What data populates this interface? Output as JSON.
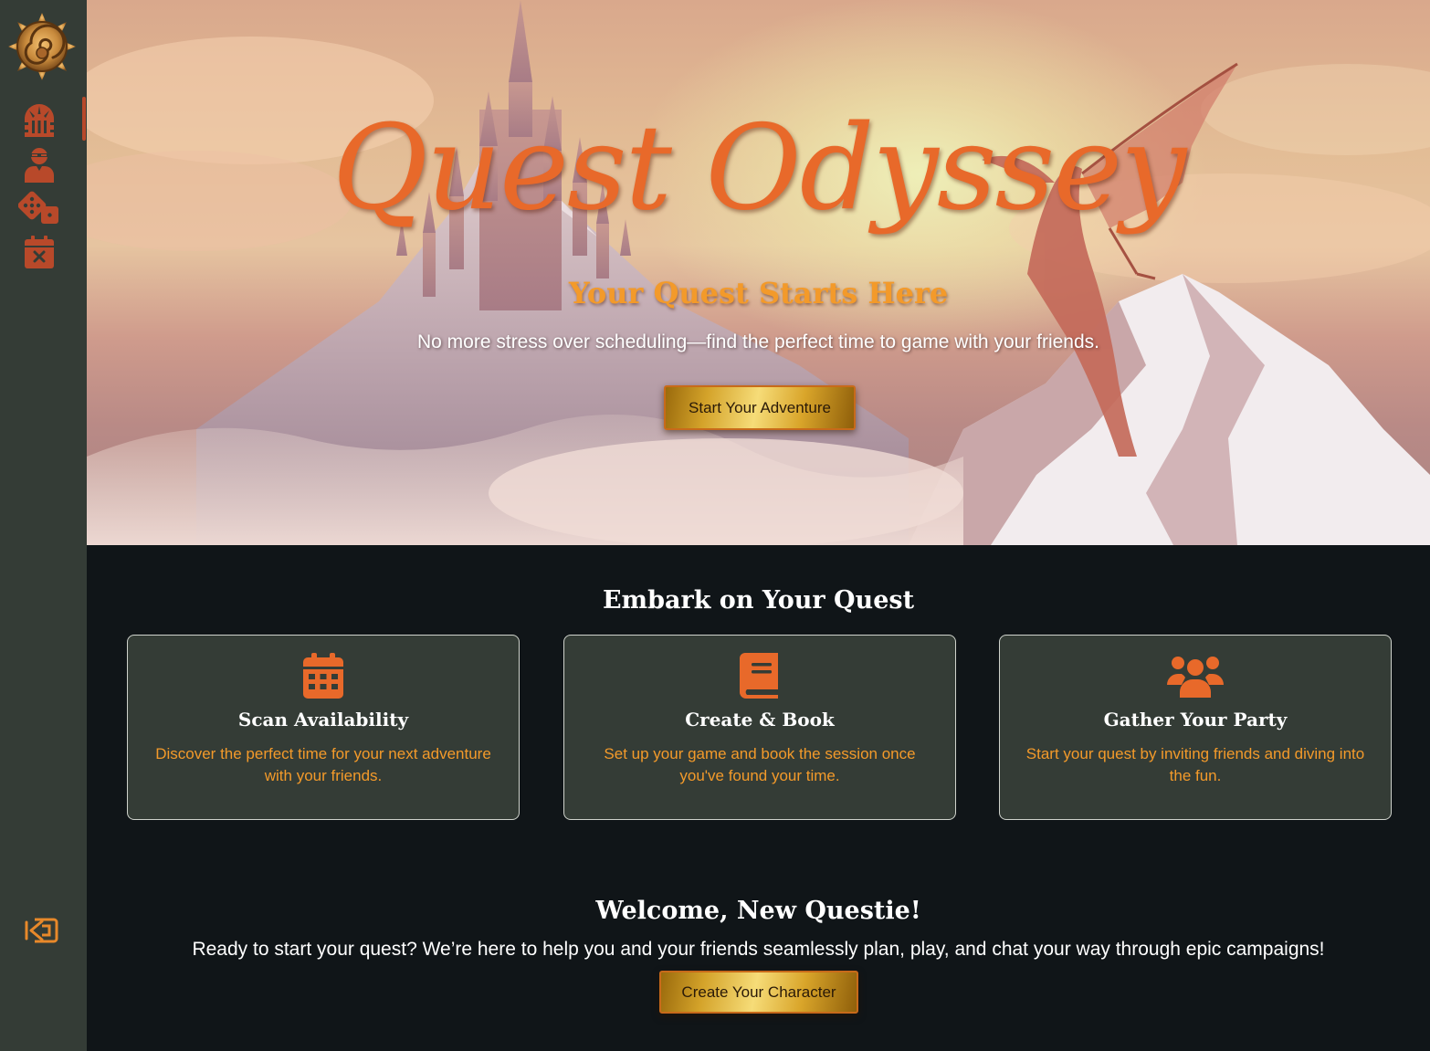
{
  "sidebar": {
    "logo": "spiral-sun-emblem-logo",
    "items": [
      {
        "name": "dungeon-door-icon",
        "active": true
      },
      {
        "name": "character-icon",
        "active": false
      },
      {
        "name": "dice-icon",
        "active": false
      },
      {
        "name": "calendar-cancel-icon",
        "active": false
      }
    ],
    "logout": "logout-icon"
  },
  "hero": {
    "title": "Quest Odyssey",
    "subtitle": "Your Quest Starts Here",
    "tagline": "No more stress over scheduling—find the perfect time to game with your friends.",
    "cta_label": "Start Your Adventure"
  },
  "features": {
    "title": "Embark on Your Quest",
    "cards": [
      {
        "icon": "calendar-icon",
        "title": "Scan Availability",
        "description": "Discover the perfect time for your next adventure with your friends."
      },
      {
        "icon": "book-icon",
        "title": "Create & Book",
        "description": "Set up your game and book the session once you've found your time."
      },
      {
        "icon": "group-icon",
        "title": "Gather Your Party",
        "description": "Start your quest by inviting friends and diving into the fun."
      }
    ]
  },
  "welcome": {
    "title": "Welcome, New Questie!",
    "text": "Ready to start your quest? We’re here to help you and your friends seamlessly plan, play, and chat your way through epic campaigns!",
    "cta_label": "Create Your Character"
  },
  "colors": {
    "accent": "#e8692a",
    "icon": "#b8492a",
    "gold": "#d4a32a",
    "sidebar": "#343c36",
    "background": "#101518"
  }
}
